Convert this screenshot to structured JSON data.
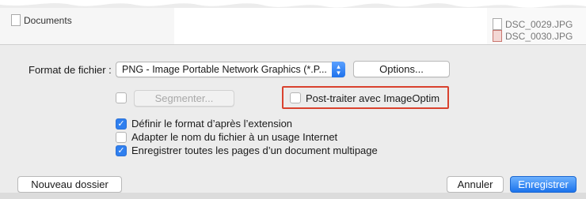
{
  "top_strip": {
    "documents_label": "Documents",
    "file_1": "DSC_0029.JPG",
    "file_2": "DSC_0030.JPG"
  },
  "format": {
    "label": "Format de fichier :",
    "selected": "PNG - Image Portable Network Graphics (*.P...",
    "options_button": "Options..."
  },
  "split": {
    "button": "Segmenter...",
    "checked": false
  },
  "imageoptim": {
    "label": "Post-traiter avec ImageOptim",
    "checked": false,
    "highlight_color": "#d9422e"
  },
  "checkboxes": [
    {
      "label": "Définir le format d’après l’extension",
      "checked": true
    },
    {
      "label": "Adapter le nom du fichier à un usage Internet",
      "checked": false
    },
    {
      "label": "Enregistrer toutes les pages d’un document multipage",
      "checked": true
    }
  ],
  "footer": {
    "new_folder": "Nouveau dossier",
    "cancel": "Annuler",
    "save": "Enregistrer"
  },
  "colors": {
    "accent": "#1f72ec",
    "background": "#ececec"
  }
}
